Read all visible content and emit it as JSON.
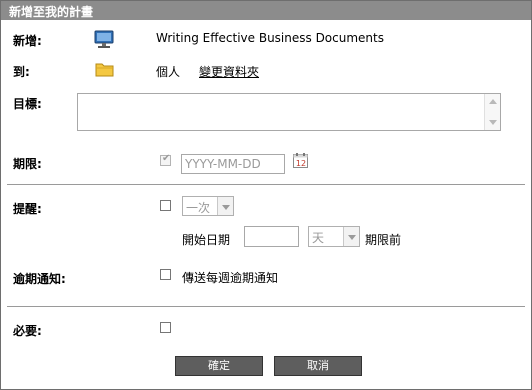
{
  "title": "新增至我的計畫",
  "fields": {
    "add_label": "新增:",
    "add_value": "Writing Effective Business Documents",
    "to_label": "到:",
    "to_folder": "個人",
    "change_folder_link": "變更資料夾",
    "goal_label": "目標:",
    "goal_value": "",
    "deadline_label": "期限:",
    "deadline_placeholder": "YYYY-MM-DD",
    "reminder_label": "提醒:",
    "reminder_freq": "一次",
    "start_date_label": "開始日期",
    "start_date_value": "",
    "unit_value": "天",
    "before_deadline_label": "期限前",
    "overdue_label": "逾期通知:",
    "overdue_checkbox_label": "傳送每週逾期通知",
    "required_label": "必要:"
  },
  "buttons": {
    "ok": "確定",
    "cancel": "取消"
  },
  "state": {
    "deadline_checked": true,
    "deadline_disabled": true,
    "reminder_checked": false,
    "overdue_checked": false,
    "required_checked": false
  },
  "colors": {
    "titlebar": "#8c8c8c",
    "button": "#5e5e5e"
  },
  "icons": {
    "course": "monitor-icon",
    "folder": "folder-icon",
    "calendar": "calendar-icon"
  }
}
